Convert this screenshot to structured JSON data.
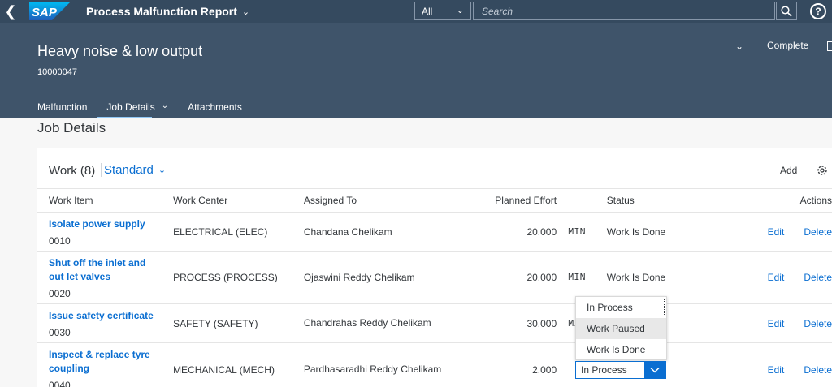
{
  "shell": {
    "app_title": "Process Malfunction Report",
    "scope": "All",
    "search_placeholder": "Search"
  },
  "header": {
    "title": "Heavy noise & low output",
    "id": "10000047",
    "complete_label": "Complete",
    "tabs": [
      {
        "label": "Malfunction"
      },
      {
        "label": "Job Details"
      },
      {
        "label": "Attachments"
      }
    ]
  },
  "section": {
    "title": "Job Details",
    "table_title": "Work (8)",
    "variant": "Standard",
    "add_label": "Add"
  },
  "columns": {
    "work_item": "Work Item",
    "work_center": "Work Center",
    "assigned_to": "Assigned To",
    "planned_effort": "Planned Effort",
    "status": "Status",
    "actions": "Actions"
  },
  "rows": [
    {
      "title": "Isolate power supply",
      "num": "0010",
      "center": "ELECTRICAL (ELEC)",
      "assigned": "Chandana Chelikam",
      "effort": "20.000",
      "unit": "MIN",
      "status": "Work Is Done",
      "edit": "Edit",
      "delete": "Delete"
    },
    {
      "title": "Shut off the inlet and out let valves",
      "num": "0020",
      "center": "PROCESS (PROCESS)",
      "assigned": "Ojaswini Reddy Chelikam",
      "effort": "20.000",
      "unit": "MIN",
      "status": "Work Is Done",
      "edit": "Edit",
      "delete": "Delete"
    },
    {
      "title": "Issue safety certificate",
      "num": "0030",
      "center": "SAFETY (SAFETY)",
      "assigned": "Chandrahas Reddy Chelikam",
      "effort": "30.000",
      "unit": "MIN",
      "status": "",
      "edit": "Edit",
      "delete": "Delete"
    },
    {
      "title": "Inspect & replace tyre coupling",
      "num": "0040",
      "center": "MECHANICAL (MECH)",
      "assigned": "Pardhasaradhi Reddy Chelikam",
      "effort": "2.000",
      "unit": "H",
      "status": "",
      "edit": "Edit",
      "delete": "Delete"
    }
  ],
  "status_select": {
    "value": "In Process",
    "options": [
      "In Process",
      "Work Paused",
      "Work Is Done"
    ]
  },
  "colors": {
    "shell": "#354a5f",
    "header": "#3f546a",
    "link": "#0a6ed1"
  }
}
